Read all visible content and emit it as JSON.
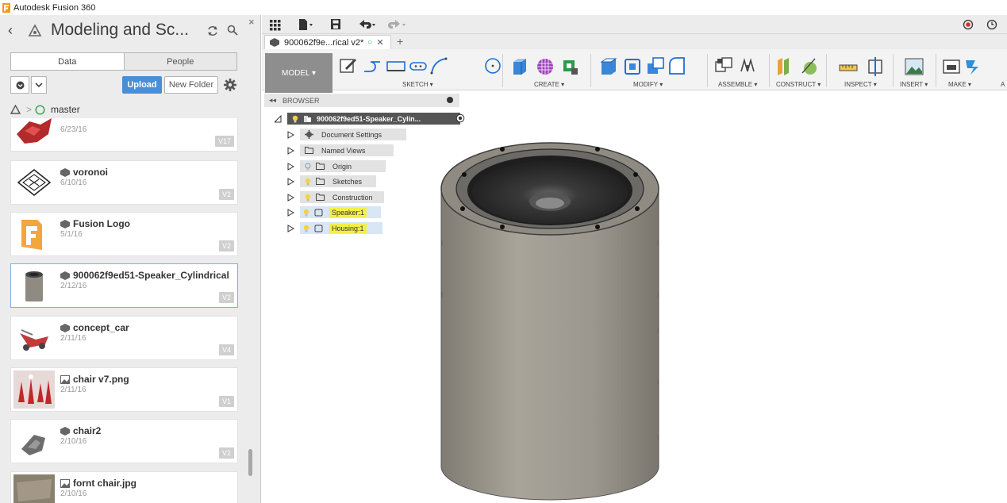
{
  "window": {
    "title": "Autodesk Fusion 360"
  },
  "data_panel": {
    "title": "Modeling and Sc...",
    "tabs": {
      "data": "Data",
      "people": "People"
    },
    "upload_label": "Upload",
    "new_folder_label": "New Folder",
    "breadcrumb": "master",
    "items": [
      {
        "name": "",
        "date": "6/23/16",
        "version": "V17"
      },
      {
        "name": "voronoi",
        "date": "6/10/16",
        "version": "V2"
      },
      {
        "name": "Fusion Logo",
        "date": "5/1/16",
        "version": "V2"
      },
      {
        "name": "900062f9ed51-Speaker_Cylindrical",
        "date": "2/12/16",
        "version": "V2",
        "selected": true
      },
      {
        "name": "concept_car",
        "date": "2/11/16",
        "version": "V4"
      },
      {
        "name": "chair v7.png",
        "date": "2/11/16",
        "version": "V1"
      },
      {
        "name": "chair2",
        "date": "2/10/16",
        "version": "V2"
      },
      {
        "name": "fornt chair.jpg",
        "date": "2/10/16",
        "version": ""
      }
    ]
  },
  "document": {
    "tab_label": "900062f9e...rical v2*",
    "workspace_label": "MODEL ▾"
  },
  "toolbar_groups": {
    "sketch": "SKETCH ▾",
    "create": "CREATE ▾",
    "modify": "MODIFY ▾",
    "assemble": "ASSEMBLE ▾",
    "construct": "CONSTRUCT ▾",
    "inspect": "INSPECT ▾",
    "insert": "INSERT ▾",
    "make": "MAKE ▾",
    "addins": "A"
  },
  "browser": {
    "header": "BROWSER",
    "root": "900062f9ed51-Speaker_Cylin...",
    "nodes": {
      "doc_settings": "Document Settings",
      "named_views": "Named Views",
      "origin": "Origin",
      "sketches": "Sketches",
      "construction": "Construction",
      "speaker": "Speaker:1",
      "housing": "Housing:1"
    }
  },
  "colors": {
    "accent": "#4a8fd6",
    "highlight": "#f2ef4a",
    "model_body": "#9b978e",
    "record": "#d0312d"
  }
}
